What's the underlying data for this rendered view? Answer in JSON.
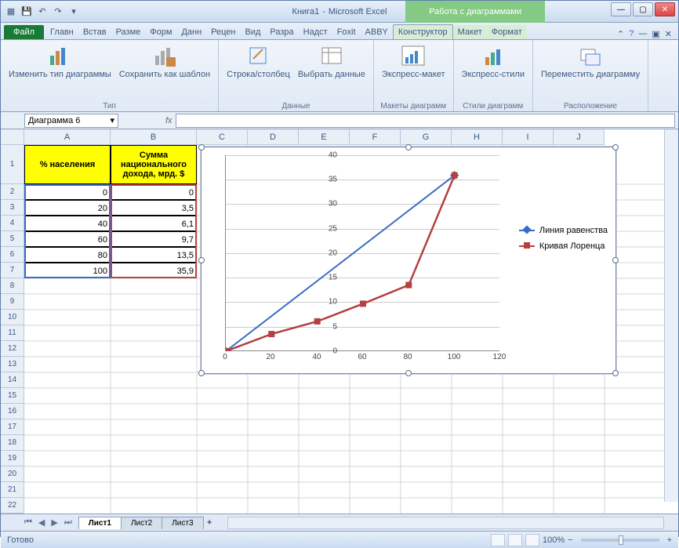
{
  "window": {
    "doc_title": "Книга1",
    "app_title": "Microsoft Excel",
    "chart_tools_title": "Работа с диаграммами"
  },
  "qat": {
    "save": "save",
    "undo": "undo",
    "redo": "redo"
  },
  "tabs": {
    "file": "Файл",
    "items": [
      "Главн",
      "Встав",
      "Разме",
      "Форм",
      "Данн",
      "Рецен",
      "Вид",
      "Разра",
      "Надст",
      "Foxit",
      "ABBY"
    ],
    "chart_tabs": [
      "Конструктор",
      "Макет",
      "Формат"
    ],
    "active": "Конструктор"
  },
  "ribbon": {
    "type_group": "Тип",
    "change_type": "Изменить тип диаграммы",
    "save_template": "Сохранить как шаблон",
    "data_group": "Данные",
    "row_col": "Строка/столбец",
    "select_data": "Выбрать данные",
    "layouts_group": "Макеты диаграмм",
    "express_layout": "Экспресс-макет",
    "styles_group": "Стили диаграмм",
    "express_styles": "Экспресс-стили",
    "location_group": "Расположение",
    "move_chart": "Переместить диаграмму"
  },
  "name_box": "Диаграмма 6",
  "fx_label": "fx",
  "columns": [
    "A",
    "B",
    "C",
    "D",
    "E",
    "F",
    "G",
    "H",
    "I",
    "J"
  ],
  "col_widths": {
    "A": 110,
    "B": 110,
    "other": 65
  },
  "table": {
    "header_a": "% населения",
    "header_b": "Сумма национального дохода, мрд. $",
    "rows": [
      {
        "a": "0",
        "b": "0"
      },
      {
        "a": "20",
        "b": "3,5"
      },
      {
        "a": "40",
        "b": "6,1"
      },
      {
        "a": "60",
        "b": "9,7"
      },
      {
        "a": "80",
        "b": "13,5"
      },
      {
        "a": "100",
        "b": "35,9"
      }
    ]
  },
  "chart_data": {
    "type": "line",
    "x": [
      0,
      20,
      40,
      60,
      80,
      100
    ],
    "series": [
      {
        "name": "Линия равенства",
        "values": [
          0,
          35.9
        ],
        "x": [
          0,
          100
        ],
        "color": "#3b6cc4"
      },
      {
        "name": "Кривая Лоренца",
        "values": [
          0,
          3.5,
          6.1,
          9.7,
          13.5,
          35.9
        ],
        "x": [
          0,
          20,
          40,
          60,
          80,
          100
        ],
        "color": "#b44040"
      }
    ],
    "xlim": [
      0,
      120
    ],
    "ylim": [
      0,
      40
    ],
    "xticks": [
      0,
      20,
      40,
      60,
      80,
      100,
      120
    ],
    "yticks": [
      0,
      5,
      10,
      15,
      20,
      25,
      30,
      35,
      40
    ],
    "legend": [
      "Линия равенства",
      "Кривая Лоренца"
    ]
  },
  "sheets": {
    "tabs": [
      "Лист1",
      "Лист2",
      "Лист3"
    ],
    "active": "Лист1"
  },
  "status": {
    "ready": "Готово",
    "zoom": "100%"
  }
}
